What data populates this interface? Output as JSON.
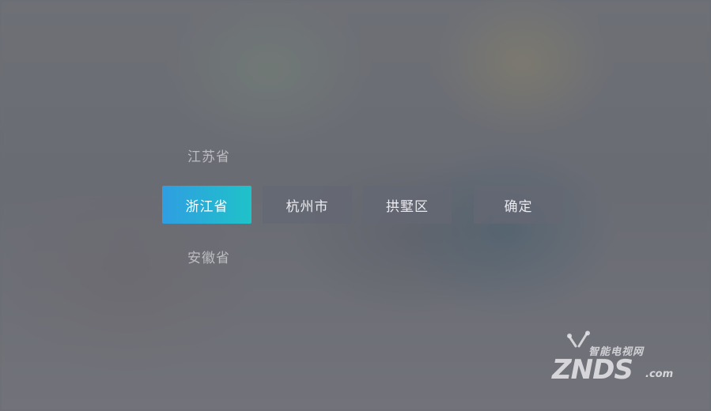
{
  "picker": {
    "province_above": "江苏省",
    "province_selected": "浙江省",
    "province_below": "安徽省",
    "city": "杭州市",
    "district": "拱墅区",
    "confirm_label": "确定"
  },
  "watermark": {
    "cn_text": "智能电视网",
    "en_text": "ZNDS",
    "domain_text": ".com"
  },
  "colors": {
    "selected_gradient_start": "#2f9ee2",
    "selected_gradient_end": "#1fc2c9",
    "button_bg": "#646873"
  }
}
